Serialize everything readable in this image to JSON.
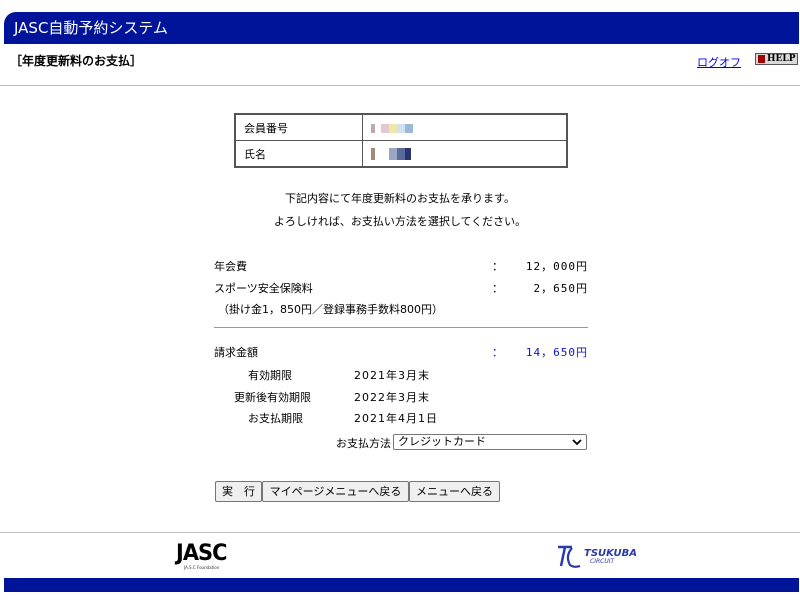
{
  "header": {
    "title": "JASC自動予約システム"
  },
  "page": {
    "heading": "［年度更新料のお支払］"
  },
  "nav": {
    "logoff": "ログオフ",
    "help": "HELP"
  },
  "member": {
    "rows": [
      {
        "label": "会員番号"
      },
      {
        "label": "氏名"
      }
    ]
  },
  "messages": {
    "line1": "下記内容にて年度更新料のお支払を承ります。",
    "line2": "よろしければ、お支払い方法を選択してください。"
  },
  "fees": {
    "annual": {
      "label": "年会費",
      "sep": "：",
      "value": "12，000円"
    },
    "insurance": {
      "label": "スポーツ安全保険料",
      "sep": "：",
      "value": "2，650円"
    },
    "insurance_note": "（掛け金1，850円／登録事務手数料800円）",
    "total": {
      "label": "請求金額",
      "sep": "：",
      "value": "14，650円"
    }
  },
  "periods": [
    {
      "label": "有効期限",
      "value": "2021年3月末"
    },
    {
      "label": "更新後有効期限",
      "value": "2022年3月末"
    },
    {
      "label": "お支払期限",
      "value": "2021年4月1日"
    }
  ],
  "payment": {
    "label": "お支払方法",
    "selected": "クレジットカード"
  },
  "buttons": {
    "execute": "実　行",
    "mypage": "マイページメニューへ戻る",
    "menu": "メニューへ戻る"
  },
  "footer": {
    "jasc_logo": "JASC",
    "jasc_sub": "JA.S.C Foundation",
    "tsukuba_logo": "TSUKUBA",
    "tsukuba_sub": "CIRCUIT"
  },
  "colors": {
    "brand_blue": "#00149a",
    "link": "#0000ee",
    "total_blue": "#1111cc"
  }
}
